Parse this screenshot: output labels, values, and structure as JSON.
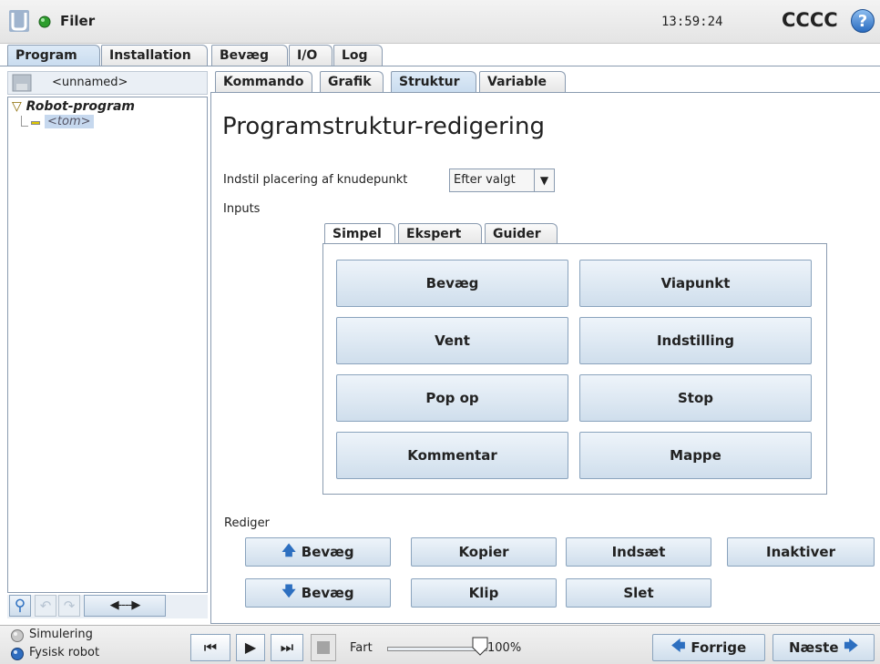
{
  "titlebar": {
    "title": "Filer",
    "time": "13:59:24",
    "user": "CCCC",
    "help": "?"
  },
  "main_tabs": [
    "Program",
    "Installation",
    "Bevæg",
    "I/O",
    "Log"
  ],
  "left_panel": {
    "file_name": "<unnamed>",
    "tree_root": "Robot-program",
    "tree_child": "<tom>"
  },
  "sub_tabs": [
    "Kommando",
    "Grafik",
    "Struktur",
    "Variable"
  ],
  "editor": {
    "heading": "Programstruktur-redigering",
    "placement_label": "Indstil placering af knudepunkt",
    "placement_value": "Efter valgt",
    "inputs_label": "Inputs",
    "input_tabs": [
      "Simpel",
      "Ekspert",
      "Guider"
    ],
    "buttons": [
      "Bevæg",
      "Viapunkt",
      "Vent",
      "Indstilling",
      "Pop op",
      "Stop",
      "Kommentar",
      "Mappe"
    ],
    "edit_label": "Rediger",
    "edit_buttons": {
      "move_up": "Bevæg",
      "copy": "Kopier",
      "paste": "Indsæt",
      "deactivate": "Inaktiver",
      "move_down": "Bevæg",
      "cut": "Klip",
      "delete": "Slet"
    }
  },
  "bottom": {
    "simulation": "Simulering",
    "physical": "Fysisk robot",
    "speed_label": "Fart",
    "speed_value": "100%",
    "speed_fraction": 1.0,
    "prev": "Forrige",
    "next": "Næste"
  }
}
